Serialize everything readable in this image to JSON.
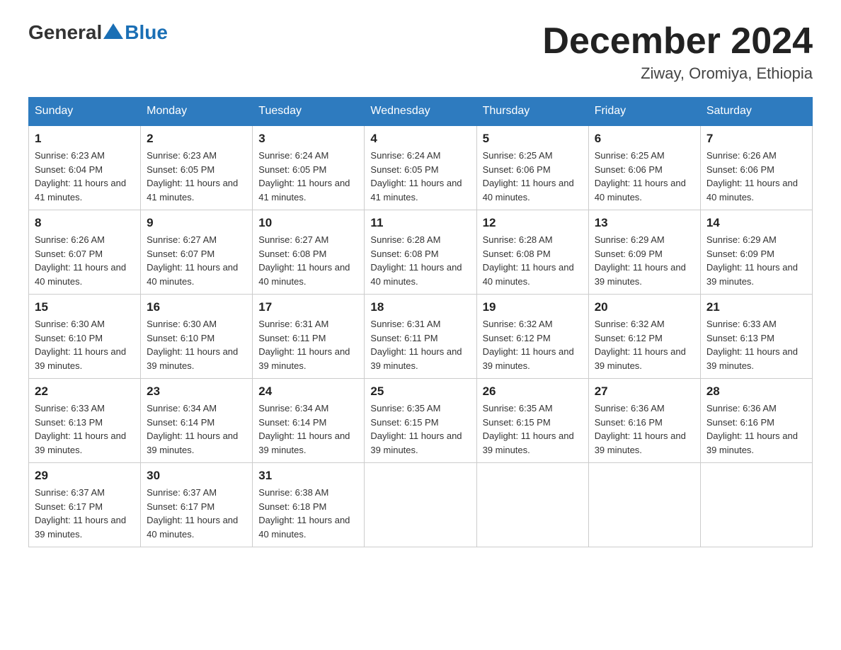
{
  "header": {
    "logo_general": "General",
    "logo_blue": "Blue",
    "month_title": "December 2024",
    "location": "Ziway, Oromiya, Ethiopia"
  },
  "days_of_week": [
    "Sunday",
    "Monday",
    "Tuesday",
    "Wednesday",
    "Thursday",
    "Friday",
    "Saturday"
  ],
  "weeks": [
    [
      {
        "day": "1",
        "sunrise": "6:23 AM",
        "sunset": "6:04 PM",
        "daylight": "11 hours and 41 minutes."
      },
      {
        "day": "2",
        "sunrise": "6:23 AM",
        "sunset": "6:05 PM",
        "daylight": "11 hours and 41 minutes."
      },
      {
        "day": "3",
        "sunrise": "6:24 AM",
        "sunset": "6:05 PM",
        "daylight": "11 hours and 41 minutes."
      },
      {
        "day": "4",
        "sunrise": "6:24 AM",
        "sunset": "6:05 PM",
        "daylight": "11 hours and 41 minutes."
      },
      {
        "day": "5",
        "sunrise": "6:25 AM",
        "sunset": "6:06 PM",
        "daylight": "11 hours and 40 minutes."
      },
      {
        "day": "6",
        "sunrise": "6:25 AM",
        "sunset": "6:06 PM",
        "daylight": "11 hours and 40 minutes."
      },
      {
        "day": "7",
        "sunrise": "6:26 AM",
        "sunset": "6:06 PM",
        "daylight": "11 hours and 40 minutes."
      }
    ],
    [
      {
        "day": "8",
        "sunrise": "6:26 AM",
        "sunset": "6:07 PM",
        "daylight": "11 hours and 40 minutes."
      },
      {
        "day": "9",
        "sunrise": "6:27 AM",
        "sunset": "6:07 PM",
        "daylight": "11 hours and 40 minutes."
      },
      {
        "day": "10",
        "sunrise": "6:27 AM",
        "sunset": "6:08 PM",
        "daylight": "11 hours and 40 minutes."
      },
      {
        "day": "11",
        "sunrise": "6:28 AM",
        "sunset": "6:08 PM",
        "daylight": "11 hours and 40 minutes."
      },
      {
        "day": "12",
        "sunrise": "6:28 AM",
        "sunset": "6:08 PM",
        "daylight": "11 hours and 40 minutes."
      },
      {
        "day": "13",
        "sunrise": "6:29 AM",
        "sunset": "6:09 PM",
        "daylight": "11 hours and 39 minutes."
      },
      {
        "day": "14",
        "sunrise": "6:29 AM",
        "sunset": "6:09 PM",
        "daylight": "11 hours and 39 minutes."
      }
    ],
    [
      {
        "day": "15",
        "sunrise": "6:30 AM",
        "sunset": "6:10 PM",
        "daylight": "11 hours and 39 minutes."
      },
      {
        "day": "16",
        "sunrise": "6:30 AM",
        "sunset": "6:10 PM",
        "daylight": "11 hours and 39 minutes."
      },
      {
        "day": "17",
        "sunrise": "6:31 AM",
        "sunset": "6:11 PM",
        "daylight": "11 hours and 39 minutes."
      },
      {
        "day": "18",
        "sunrise": "6:31 AM",
        "sunset": "6:11 PM",
        "daylight": "11 hours and 39 minutes."
      },
      {
        "day": "19",
        "sunrise": "6:32 AM",
        "sunset": "6:12 PM",
        "daylight": "11 hours and 39 minutes."
      },
      {
        "day": "20",
        "sunrise": "6:32 AM",
        "sunset": "6:12 PM",
        "daylight": "11 hours and 39 minutes."
      },
      {
        "day": "21",
        "sunrise": "6:33 AM",
        "sunset": "6:13 PM",
        "daylight": "11 hours and 39 minutes."
      }
    ],
    [
      {
        "day": "22",
        "sunrise": "6:33 AM",
        "sunset": "6:13 PM",
        "daylight": "11 hours and 39 minutes."
      },
      {
        "day": "23",
        "sunrise": "6:34 AM",
        "sunset": "6:14 PM",
        "daylight": "11 hours and 39 minutes."
      },
      {
        "day": "24",
        "sunrise": "6:34 AM",
        "sunset": "6:14 PM",
        "daylight": "11 hours and 39 minutes."
      },
      {
        "day": "25",
        "sunrise": "6:35 AM",
        "sunset": "6:15 PM",
        "daylight": "11 hours and 39 minutes."
      },
      {
        "day": "26",
        "sunrise": "6:35 AM",
        "sunset": "6:15 PM",
        "daylight": "11 hours and 39 minutes."
      },
      {
        "day": "27",
        "sunrise": "6:36 AM",
        "sunset": "6:16 PM",
        "daylight": "11 hours and 39 minutes."
      },
      {
        "day": "28",
        "sunrise": "6:36 AM",
        "sunset": "6:16 PM",
        "daylight": "11 hours and 39 minutes."
      }
    ],
    [
      {
        "day": "29",
        "sunrise": "6:37 AM",
        "sunset": "6:17 PM",
        "daylight": "11 hours and 39 minutes."
      },
      {
        "day": "30",
        "sunrise": "6:37 AM",
        "sunset": "6:17 PM",
        "daylight": "11 hours and 40 minutes."
      },
      {
        "day": "31",
        "sunrise": "6:38 AM",
        "sunset": "6:18 PM",
        "daylight": "11 hours and 40 minutes."
      },
      null,
      null,
      null,
      null
    ]
  ]
}
